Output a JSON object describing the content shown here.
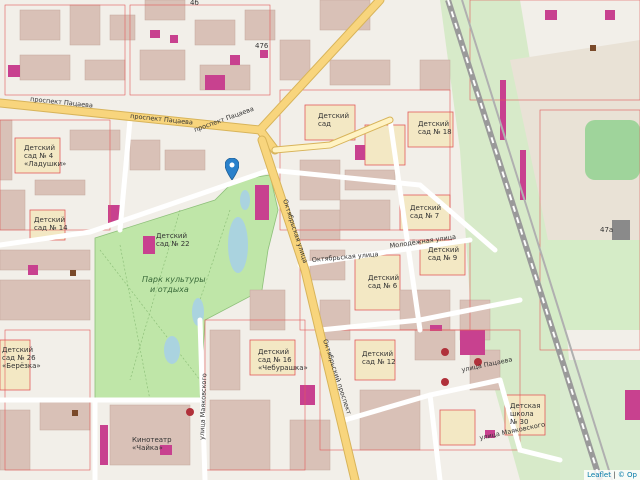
{
  "map": {
    "attribution": {
      "leaflet": "Leaflet",
      "separator": "|",
      "osm": "© Op"
    },
    "labels": {
      "prospekt_top_left": "проспект Пацаева",
      "prospekt_mid": "проспект Пацаева",
      "prospekt_right": "проспект Пацаева",
      "kindergarten_4": [
        "Детский",
        "сад № 4",
        "«Ладушки»"
      ],
      "kindergarten_left": [
        "Детский",
        "сад"
      ],
      "kindergarten_18": [
        "Детский",
        "сад № 18"
      ],
      "kindergarten_7": [
        "Детский",
        "сад № 7"
      ],
      "kindergarten_9": [
        "Детский",
        "сад № 9"
      ],
      "kindergarten_6": [
        "Детский",
        "сад № 6"
      ],
      "kindergarten_12": [
        "Детский",
        "сад № 12"
      ],
      "kindergarten_16": [
        "Детский",
        "сад № 16",
        "«Чебурашка»"
      ],
      "kindergarten_26": [
        "Детский",
        "сад № 26",
        "«Берёзка»"
      ],
      "kindergarten_14": [
        "Детский",
        "сад № 14"
      ],
      "kindergarten_22": [
        "Детский",
        "сад № 22"
      ],
      "kindergarten_30": [
        "Детская",
        "школа",
        "№ 30"
      ],
      "park": [
        "Парк культуры",
        "и отдыха"
      ],
      "street_vertical_1": "Октябрьская улица",
      "street_horizontal_1": "Октябрьская улица",
      "street_horizontal_2": "Молодёжная улица",
      "street_horizontal_3": "улица Пацаева",
      "street_bottom": "улица Маяковского",
      "street_vertical_2": "улица Маяковского",
      "boulevard_vertical": "Октябрьский проспект",
      "cinema": [
        "Кинотеатр",
        "«Чайка»"
      ],
      "house_numbers": {
        "n1": "4б",
        "n2": "476",
        "n3": "47а"
      }
    },
    "colors": {
      "background": "#f2efe9",
      "building": "#d9c1b7",
      "building_edge": "#c4a89c",
      "commercial": "#c8418f",
      "park": "#bfe6a8",
      "major_road": "#f8d57d",
      "road_edge": "#d8b45a",
      "minor_road": "#ffffff",
      "railway": "#9a9a9a",
      "school_area": "#f3e8c4",
      "water": "#aad3df",
      "boundary": "#e15a5a",
      "marker": "#2a81cb"
    }
  }
}
